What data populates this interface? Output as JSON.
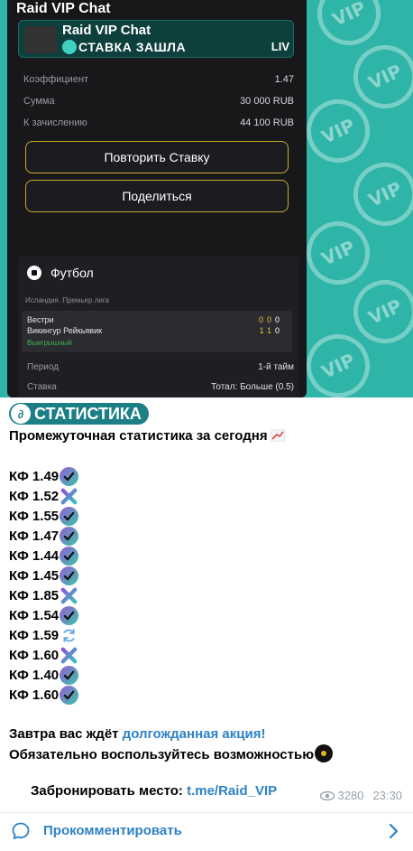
{
  "photo": {
    "chat_title": "Raid VIP Chat",
    "pinned": {
      "title": "Raid VIP Chat",
      "badge": "СТАВКА ЗАШЛА",
      "live": "LIV"
    },
    "bet_rows": [
      {
        "label": "Коэффициент",
        "value": "1.47"
      },
      {
        "label": "Сумма",
        "value": "30 000 RUB"
      },
      {
        "label": "К зачислению",
        "value": "44 100 RUB"
      }
    ],
    "repeat_button": "Повторить Ставку",
    "share_button": "Поделиться",
    "sport": "Футбол",
    "league": "Исландия. Премьер лига",
    "match": {
      "home": "Вестри",
      "away": "Викингур Рейкьявик",
      "home_score": [
        "0",
        "0",
        "0"
      ],
      "away_score": [
        "1",
        "1",
        "0"
      ],
      "result": "Выигрышный"
    },
    "info": [
      {
        "label": "Период",
        "value": "1-й тайм"
      },
      {
        "label": "Ставка",
        "value": "Тотал: Больше (0.5)"
      }
    ],
    "watermark": "VIP"
  },
  "message": {
    "badge": "СТАТИСТИКА",
    "subtitle": "Промежуточная статистика за сегодня",
    "kf_list": [
      {
        "label": "КФ 1.49",
        "status": "win"
      },
      {
        "label": "КФ 1.52",
        "status": "lose"
      },
      {
        "label": "КФ 1.55",
        "status": "win"
      },
      {
        "label": "КФ 1.47",
        "status": "win"
      },
      {
        "label": "КФ 1.44",
        "status": "win"
      },
      {
        "label": "КФ 1.45",
        "status": "win"
      },
      {
        "label": "КФ 1.85",
        "status": "lose"
      },
      {
        "label": "КФ 1.54",
        "status": "win"
      },
      {
        "label": "КФ 1.59",
        "status": "refund"
      },
      {
        "label": "КФ 1.60",
        "status": "lose"
      },
      {
        "label": "КФ 1.40",
        "status": "win"
      },
      {
        "label": "КФ 1.60",
        "status": "win"
      }
    ],
    "promo_line1_prefix": "Завтра вас ждёт ",
    "promo_line1_link": "долгожданная акция!",
    "promo_line2": "Обязательно воспользуйтесь возможностью",
    "booking_prefix": "Забронировать место: ",
    "booking_link": "t.me/Raid_VIP",
    "views": "3280",
    "time": "23:30"
  },
  "footer": {
    "comment_label": "Прокомментировать"
  },
  "colors": {
    "accent": "#2e82c6",
    "photo_bg": "#2fb5a8",
    "gold": "#c9a92a"
  }
}
